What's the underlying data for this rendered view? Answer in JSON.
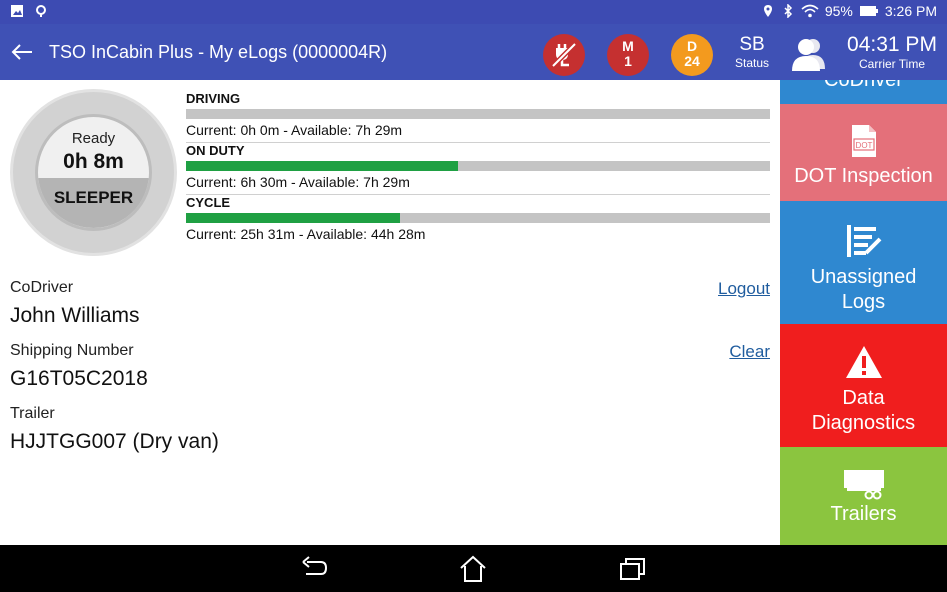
{
  "status_bar": {
    "battery": "95%",
    "time": "3:26 PM",
    "left_icons": [
      "image-icon",
      "location-pin-icon"
    ],
    "right_icons": [
      "location-icon",
      "bluetooth-icon",
      "wifi-icon",
      "battery-icon"
    ]
  },
  "app_bar": {
    "title": "TSO InCabin Plus - My eLogs (0000004R)",
    "malfunction": {
      "letter": "M",
      "count": "1"
    },
    "diagnostic": {
      "letter": "D",
      "count": "24"
    },
    "status": {
      "value": "SB",
      "label": "Status"
    },
    "carrier_time": {
      "value": "04:31 PM",
      "label": "Carrier Time"
    },
    "colors": {
      "bar": "#3f51b5",
      "alert_red": "#c53030",
      "diag_orange": "#f39a1e"
    }
  },
  "duty_dial": {
    "ready_label": "Ready",
    "time": "0h 8m",
    "status": "SLEEPER"
  },
  "clocks": [
    {
      "title": "DRIVING",
      "text": "Current: 0h 0m - Available: 7h 29m",
      "progress": 0
    },
    {
      "title": "ON DUTY",
      "text": "Current: 6h 30m - Available: 7h 29m",
      "progress": 0.465
    },
    {
      "title": "CYCLE",
      "text": "Current: 25h 31m - Available: 44h 28m",
      "progress": 0.366
    }
  ],
  "fields": {
    "codriver": {
      "label": "CoDriver",
      "value": "John Williams",
      "action": "Logout"
    },
    "shipping": {
      "label": "Shipping Number",
      "value": "G16T05C2018",
      "action": "Clear"
    },
    "trailer": {
      "label": "Trailer",
      "value": "HJJTGG007 (Dry van)"
    }
  },
  "side_menu": {
    "codriver": {
      "label": "CoDriver",
      "color": "#2f88d0"
    },
    "dot": {
      "label": "DOT Inspection",
      "color": "#e4707a",
      "icon_text": "DOT"
    },
    "unassigned": {
      "label_1": "Unassigned",
      "label_2": "Logs",
      "color": "#2f88d0"
    },
    "diagnostics": {
      "label_1": "Data",
      "label_2": "Diagnostics",
      "color": "#f01e1e"
    },
    "trailers": {
      "label": "Trailers",
      "color": "#8bc53f"
    }
  },
  "nav_bar": {
    "buttons": [
      "back-icon",
      "home-icon",
      "recent-apps-icon"
    ]
  }
}
